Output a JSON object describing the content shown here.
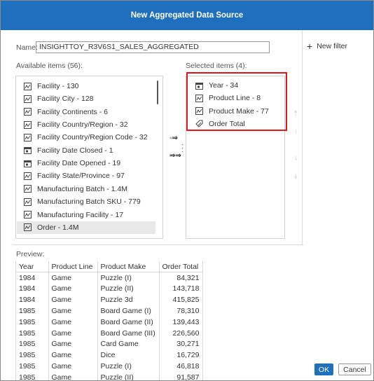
{
  "dialog": {
    "title": "New Aggregated Data Source"
  },
  "name_label": "Name:",
  "name_value": "INSIGHTTOY_R3V6S1_SALES_AGGREGATED",
  "add_filter_label": "New filter",
  "available": {
    "label": "Available items (56):",
    "items": [
      {
        "label": "Facility - 130",
        "icon": "measure-icon"
      },
      {
        "label": "Facility City - 128",
        "icon": "measure-icon"
      },
      {
        "label": "Facility Continents - 6",
        "icon": "measure-icon"
      },
      {
        "label": "Facility Country/Region - 32",
        "icon": "measure-icon"
      },
      {
        "label": "Facility Country/Region Code - 32",
        "icon": "measure-icon"
      },
      {
        "label": "Facility Date Closed - 1",
        "icon": "calendar-icon"
      },
      {
        "label": "Facility Date Opened - 19",
        "icon": "calendar-icon"
      },
      {
        "label": "Facility State/Province - 97",
        "icon": "measure-icon"
      },
      {
        "label": "Manufacturing Batch - 1.4M",
        "icon": "measure-icon"
      },
      {
        "label": "Manufacturing Batch SKU - 779",
        "icon": "measure-icon"
      },
      {
        "label": "Manufacturing Facility - 17",
        "icon": "measure-icon"
      },
      {
        "label": "Order - 1.4M",
        "icon": "measure-icon"
      }
    ]
  },
  "selected": {
    "label": "Selected items (4):",
    "items": [
      {
        "label": "Year - 34",
        "icon": "calendar-icon"
      },
      {
        "label": "Product Line - 8",
        "icon": "measure-icon"
      },
      {
        "label": "Product Make - 77",
        "icon": "measure-icon"
      },
      {
        "label": "Order Total",
        "icon": "tag-icon"
      }
    ]
  },
  "preview": {
    "label": "Preview:",
    "columns": [
      "Year",
      "Product Line",
      "Product Make",
      "Order Total"
    ],
    "rows": [
      [
        "1984",
        "Game",
        "Puzzle (I)",
        "84,321"
      ],
      [
        "1984",
        "Game",
        "Puzzle (II)",
        "143,718"
      ],
      [
        "1984",
        "Game",
        "Puzzle 3d",
        "415,825"
      ],
      [
        "1985",
        "Game",
        "Board Game (I)",
        "78,310"
      ],
      [
        "1985",
        "Game",
        "Board Game (II)",
        "139,443"
      ],
      [
        "1985",
        "Game",
        "Board Game (III)",
        "226,560"
      ],
      [
        "1985",
        "Game",
        "Card Game",
        "30,271"
      ],
      [
        "1985",
        "Game",
        "Dice",
        "16,729"
      ],
      [
        "1985",
        "Game",
        "Puzzle (I)",
        "46,818"
      ],
      [
        "1985",
        "Game",
        "Puzzle (II)",
        "91,587"
      ]
    ]
  },
  "buttons": {
    "ok": "OK",
    "cancel": "Cancel"
  },
  "colors": {
    "accent": "#1f6fbf",
    "highlight": "#e0181c"
  }
}
